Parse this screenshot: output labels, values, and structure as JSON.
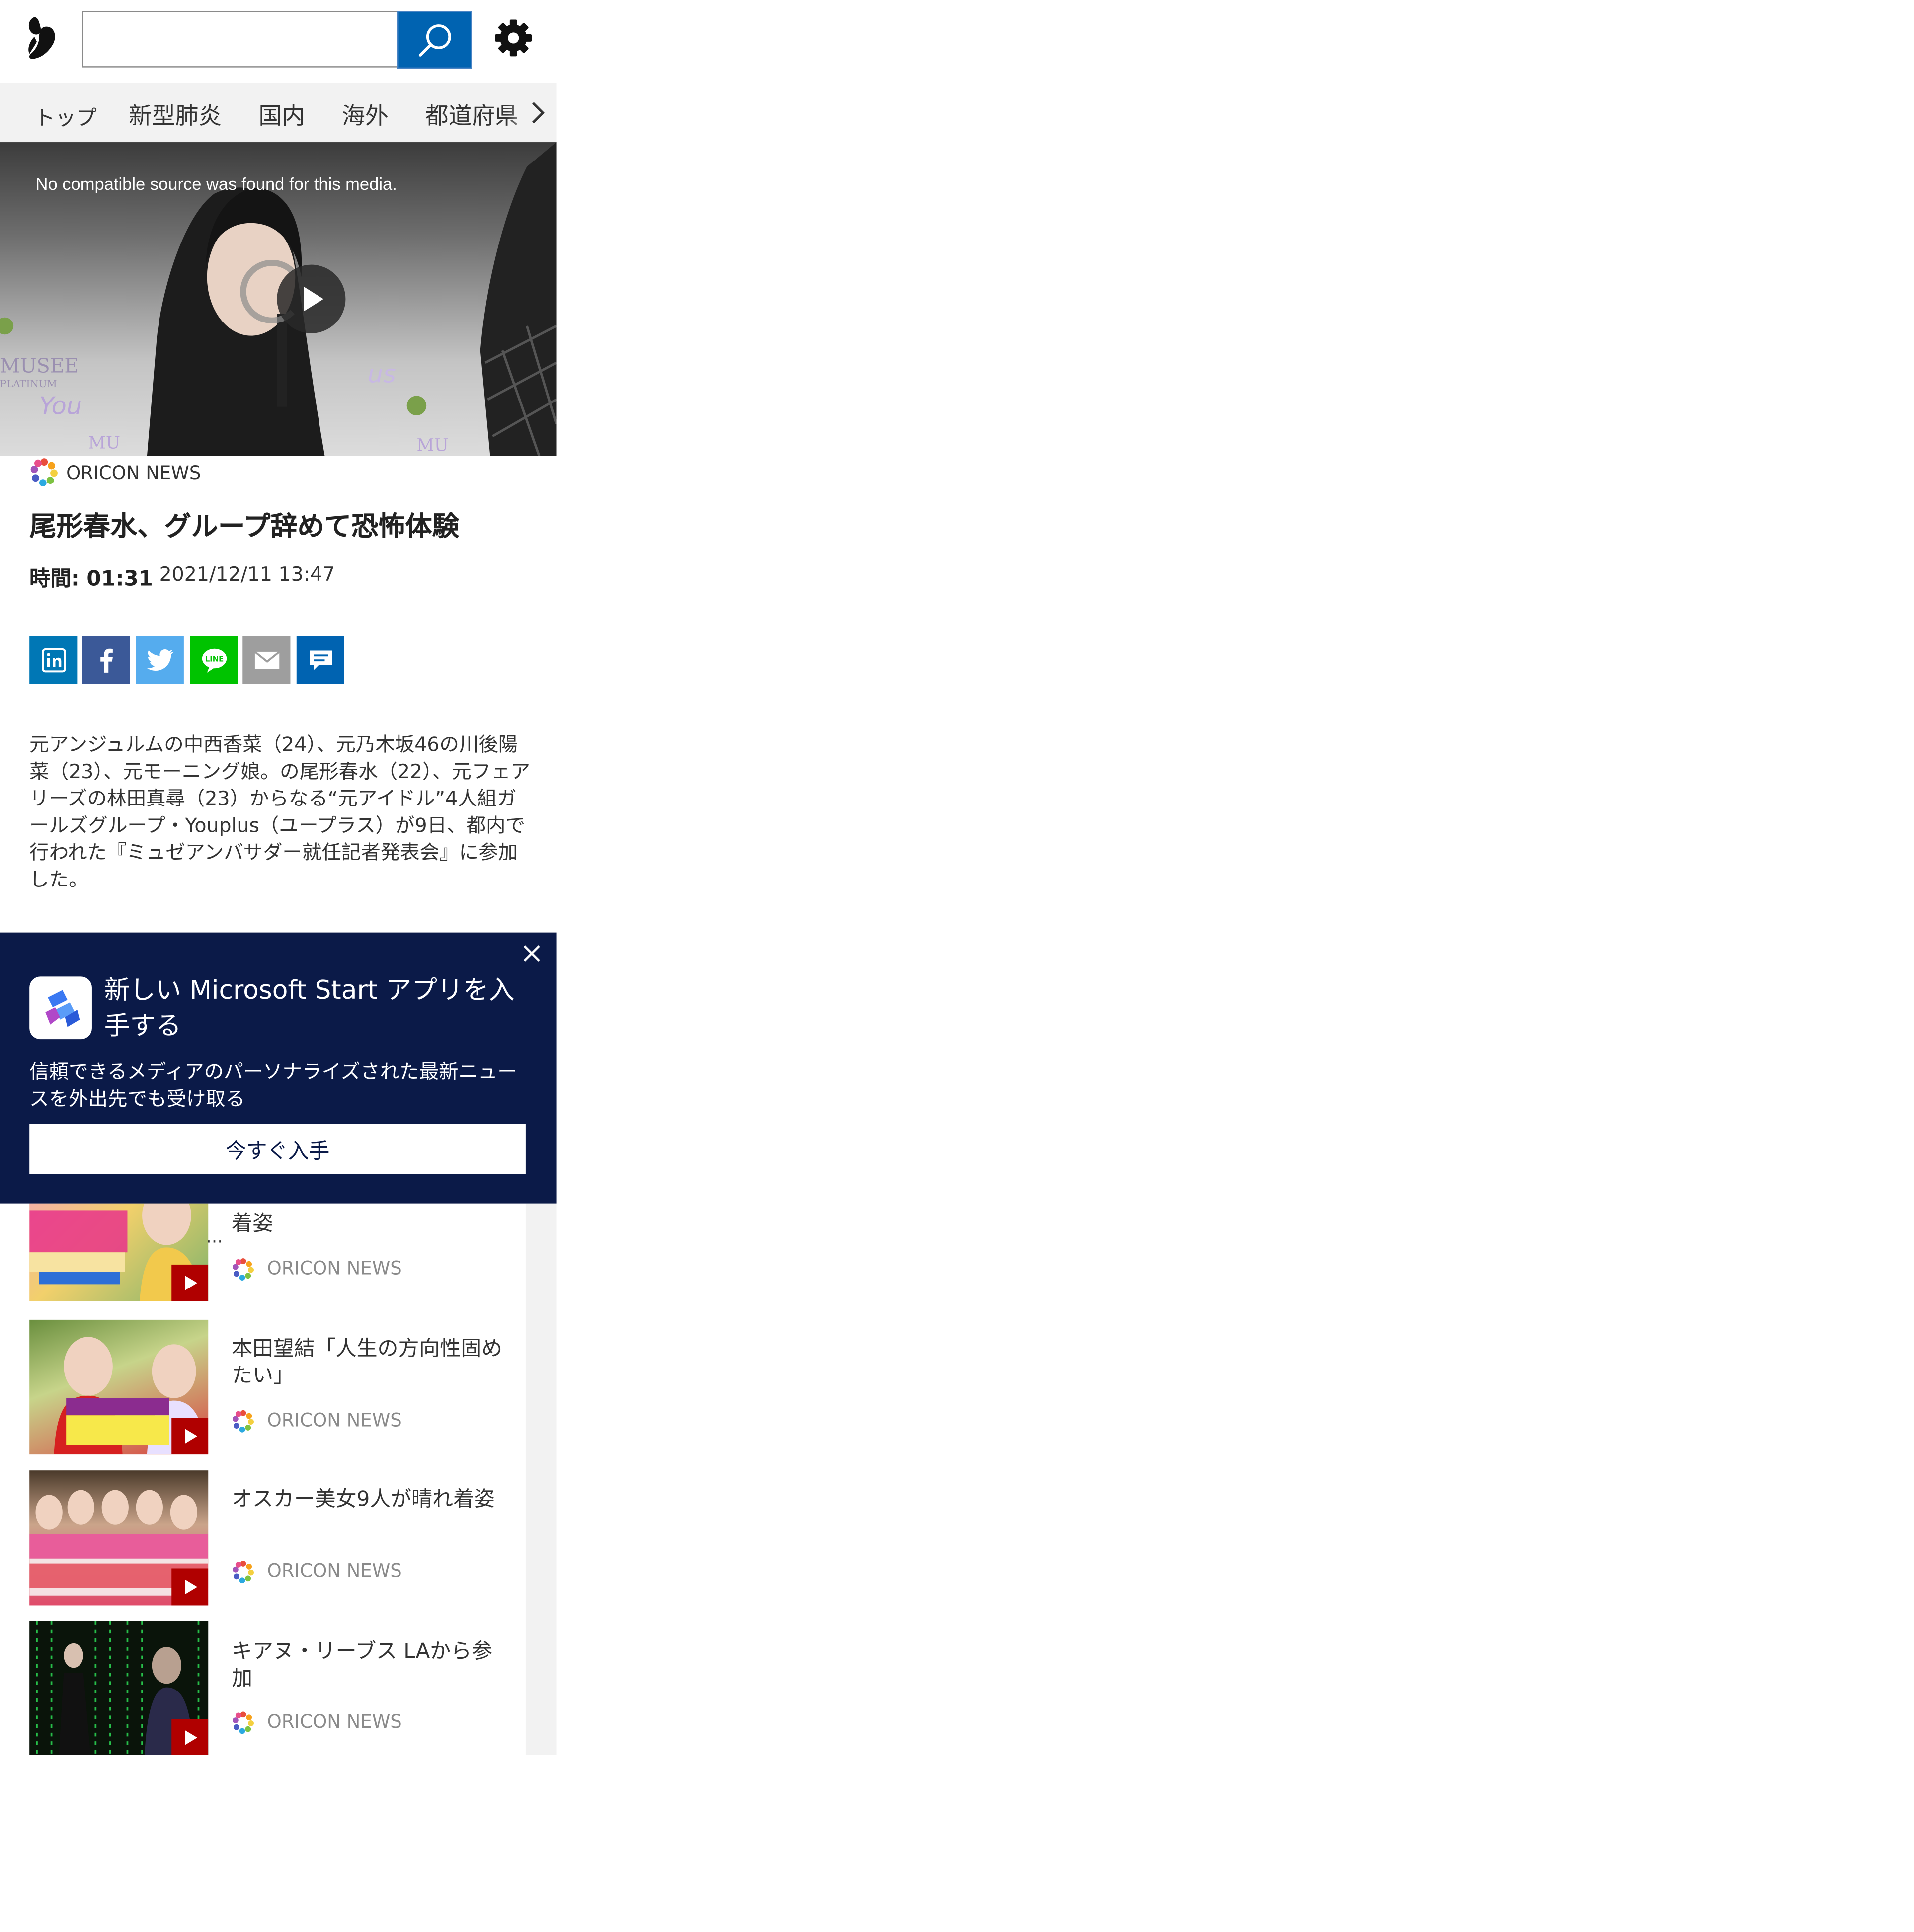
{
  "search": {
    "placeholder": "",
    "value": ""
  },
  "nav": {
    "items": [
      "トップ",
      "新型肺炎",
      "国内",
      "海外",
      "都道府県"
    ]
  },
  "video": {
    "message": "No compatible source was found for this media."
  },
  "article": {
    "source": "ORICON NEWS",
    "title": "尾形春水、グループ辞めて恐怖体験",
    "duration": "時間: 01:31",
    "date": "2021/12/11 13:47",
    "body": "元アンジュルムの中西香菜（24）、元乃木坂46の川後陽菜（23）、元モーニング娘。の尾形春水（22）、元フェアリーズの林田真尋（23）からなる“元アイドル”4人組ガールズグループ・Youplus（ユープラス）が9日、都内で行われた『ミュゼアンバサダー就任記者発表会』に参加した。"
  },
  "share": [
    "linkedin-icon",
    "facebook-icon",
    "twitter-icon",
    "line-icon",
    "mail-icon",
    "comment-icon"
  ],
  "colors": {
    "accent": "#0063b1",
    "banner_bg": "#0b1a48",
    "linkedin": "#0077b5",
    "facebook": "#3b5998",
    "twitter": "#55acee",
    "line": "#00c300",
    "mail": "#9e9e9e",
    "comment": "#0063b1"
  },
  "banner": {
    "title": "新しい Microsoft Start アプリを入手する",
    "subtitle": "信頼できるメディアのパーソナライズされた最新ニュースを外出先でも受け取る",
    "button": "今すぐ入手"
  },
  "list": {
    "items": [
      {
        "title": "着姿",
        "source": "ORICON NEWS"
      },
      {
        "title": "本田望結「人生の方向性固めたい」",
        "source": "ORICON NEWS"
      },
      {
        "title": "オスカー美女9人が晴れ着姿",
        "source": "ORICON NEWS"
      },
      {
        "title": "キアヌ・リーブス LAから参加",
        "source": "ORICON NEWS"
      }
    ]
  }
}
